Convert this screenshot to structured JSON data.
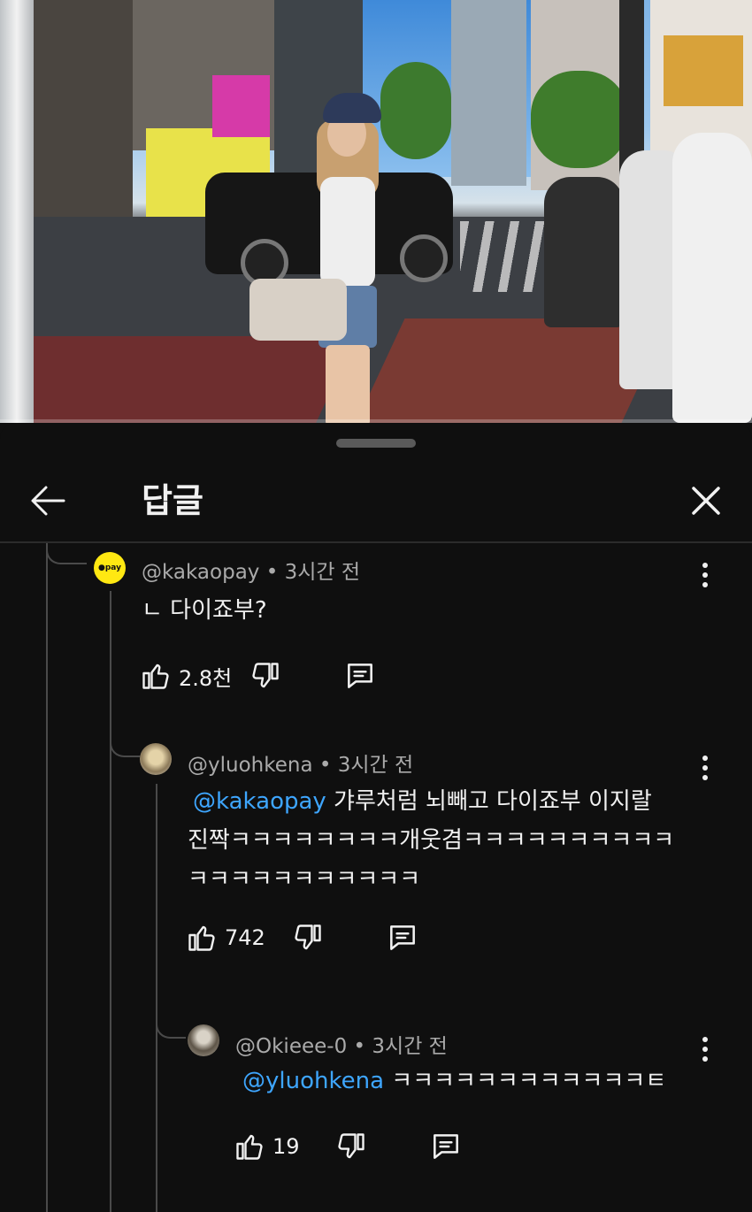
{
  "header": {
    "title": "답글"
  },
  "comments": [
    {
      "handle": "@kakaopay",
      "time": "3시간 전",
      "avatar_text": "●pay",
      "text": "ㄴ 다이죠부?",
      "likes": "2.8천"
    },
    {
      "handle": "@yluohkena",
      "time": "3시간 전",
      "mention": "@kakaopay",
      "line1_rest": " 갸루처럼 뇌빼고 다이죠부 이지랄",
      "line2": "진짝ㅋㅋㅋㅋㅋㅋㅋㅋ개웃겸ㅋㅋㅋㅋㅋㅋㅋㅋㅋㅋ",
      "line3": "ㅋㅋㅋㅋㅋㅋㅋㅋㅋㅋㅋ",
      "likes": "742"
    },
    {
      "handle": "@Okieee-0",
      "time": "3시간 전",
      "mention": "@yluohkena",
      "text_rest": " ㅋㅋㅋㅋㅋㅋㅋㅋㅋㅋㅋㅋㅌ",
      "likes": "19"
    }
  ],
  "meta_separator": " • ",
  "colors": {
    "background": "#0f0f0f",
    "text": "#f1f1f1",
    "meta": "#aaaaaa",
    "mention": "#3ea6ff",
    "kakao_yellow": "#ffe812"
  },
  "icons": {
    "back": "arrow-left-icon",
    "close": "close-icon",
    "more": "more-vert-icon",
    "like": "thumb-up-icon",
    "dislike": "thumb-down-icon",
    "reply": "reply-comment-icon"
  }
}
